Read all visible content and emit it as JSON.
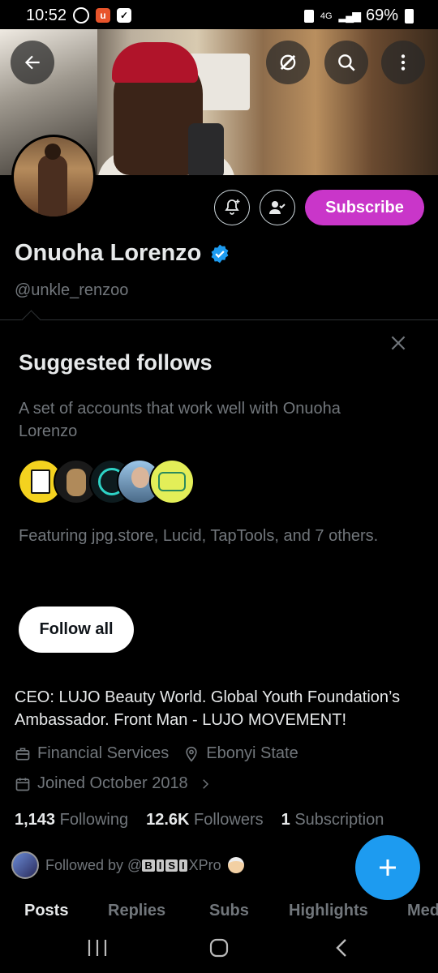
{
  "status_bar": {
    "time": "10:52",
    "network": "4G",
    "battery": "69%"
  },
  "banner": {
    "icons": [
      "back-arrow-icon",
      "grok-icon",
      "search-icon",
      "more-icon"
    ]
  },
  "profile": {
    "name": "Onuoha Lorenzo",
    "handle": "@unkle_renzoo",
    "subscribe_label": "Subscribe",
    "bio": "CEO: LUJO Beauty World. Global Youth Foundation’s Ambassador. Front Man - LUJO MOVEMENT!",
    "category": "Financial Services",
    "location": "Ebonyi State",
    "joined": "Joined October 2018",
    "stats": {
      "following_count": "1,143",
      "following_label": "Following",
      "followers_count": "12.6K",
      "followers_label": "Followers",
      "subscriptions_count": "1",
      "subscriptions_label": "Subscription"
    },
    "followed_by_prefix": "Followed by @",
    "followed_by_letters": [
      "B",
      "I",
      "S",
      "I"
    ],
    "followed_by_suffix": "XPro"
  },
  "suggested": {
    "title": "Suggested follows",
    "description": "A set of accounts that work well with Onuoha Lorenzo",
    "featuring": "Featuring jpg.store, Lucid, TapTools, and 7 others.",
    "follow_all_label": "Follow all"
  },
  "tabs": [
    "Posts",
    "Replies",
    "Subs",
    "Highlights",
    "Media"
  ],
  "colors": {
    "accent": "#1d9bf0",
    "subscribe": "#c936c9",
    "muted": "#71767b"
  }
}
